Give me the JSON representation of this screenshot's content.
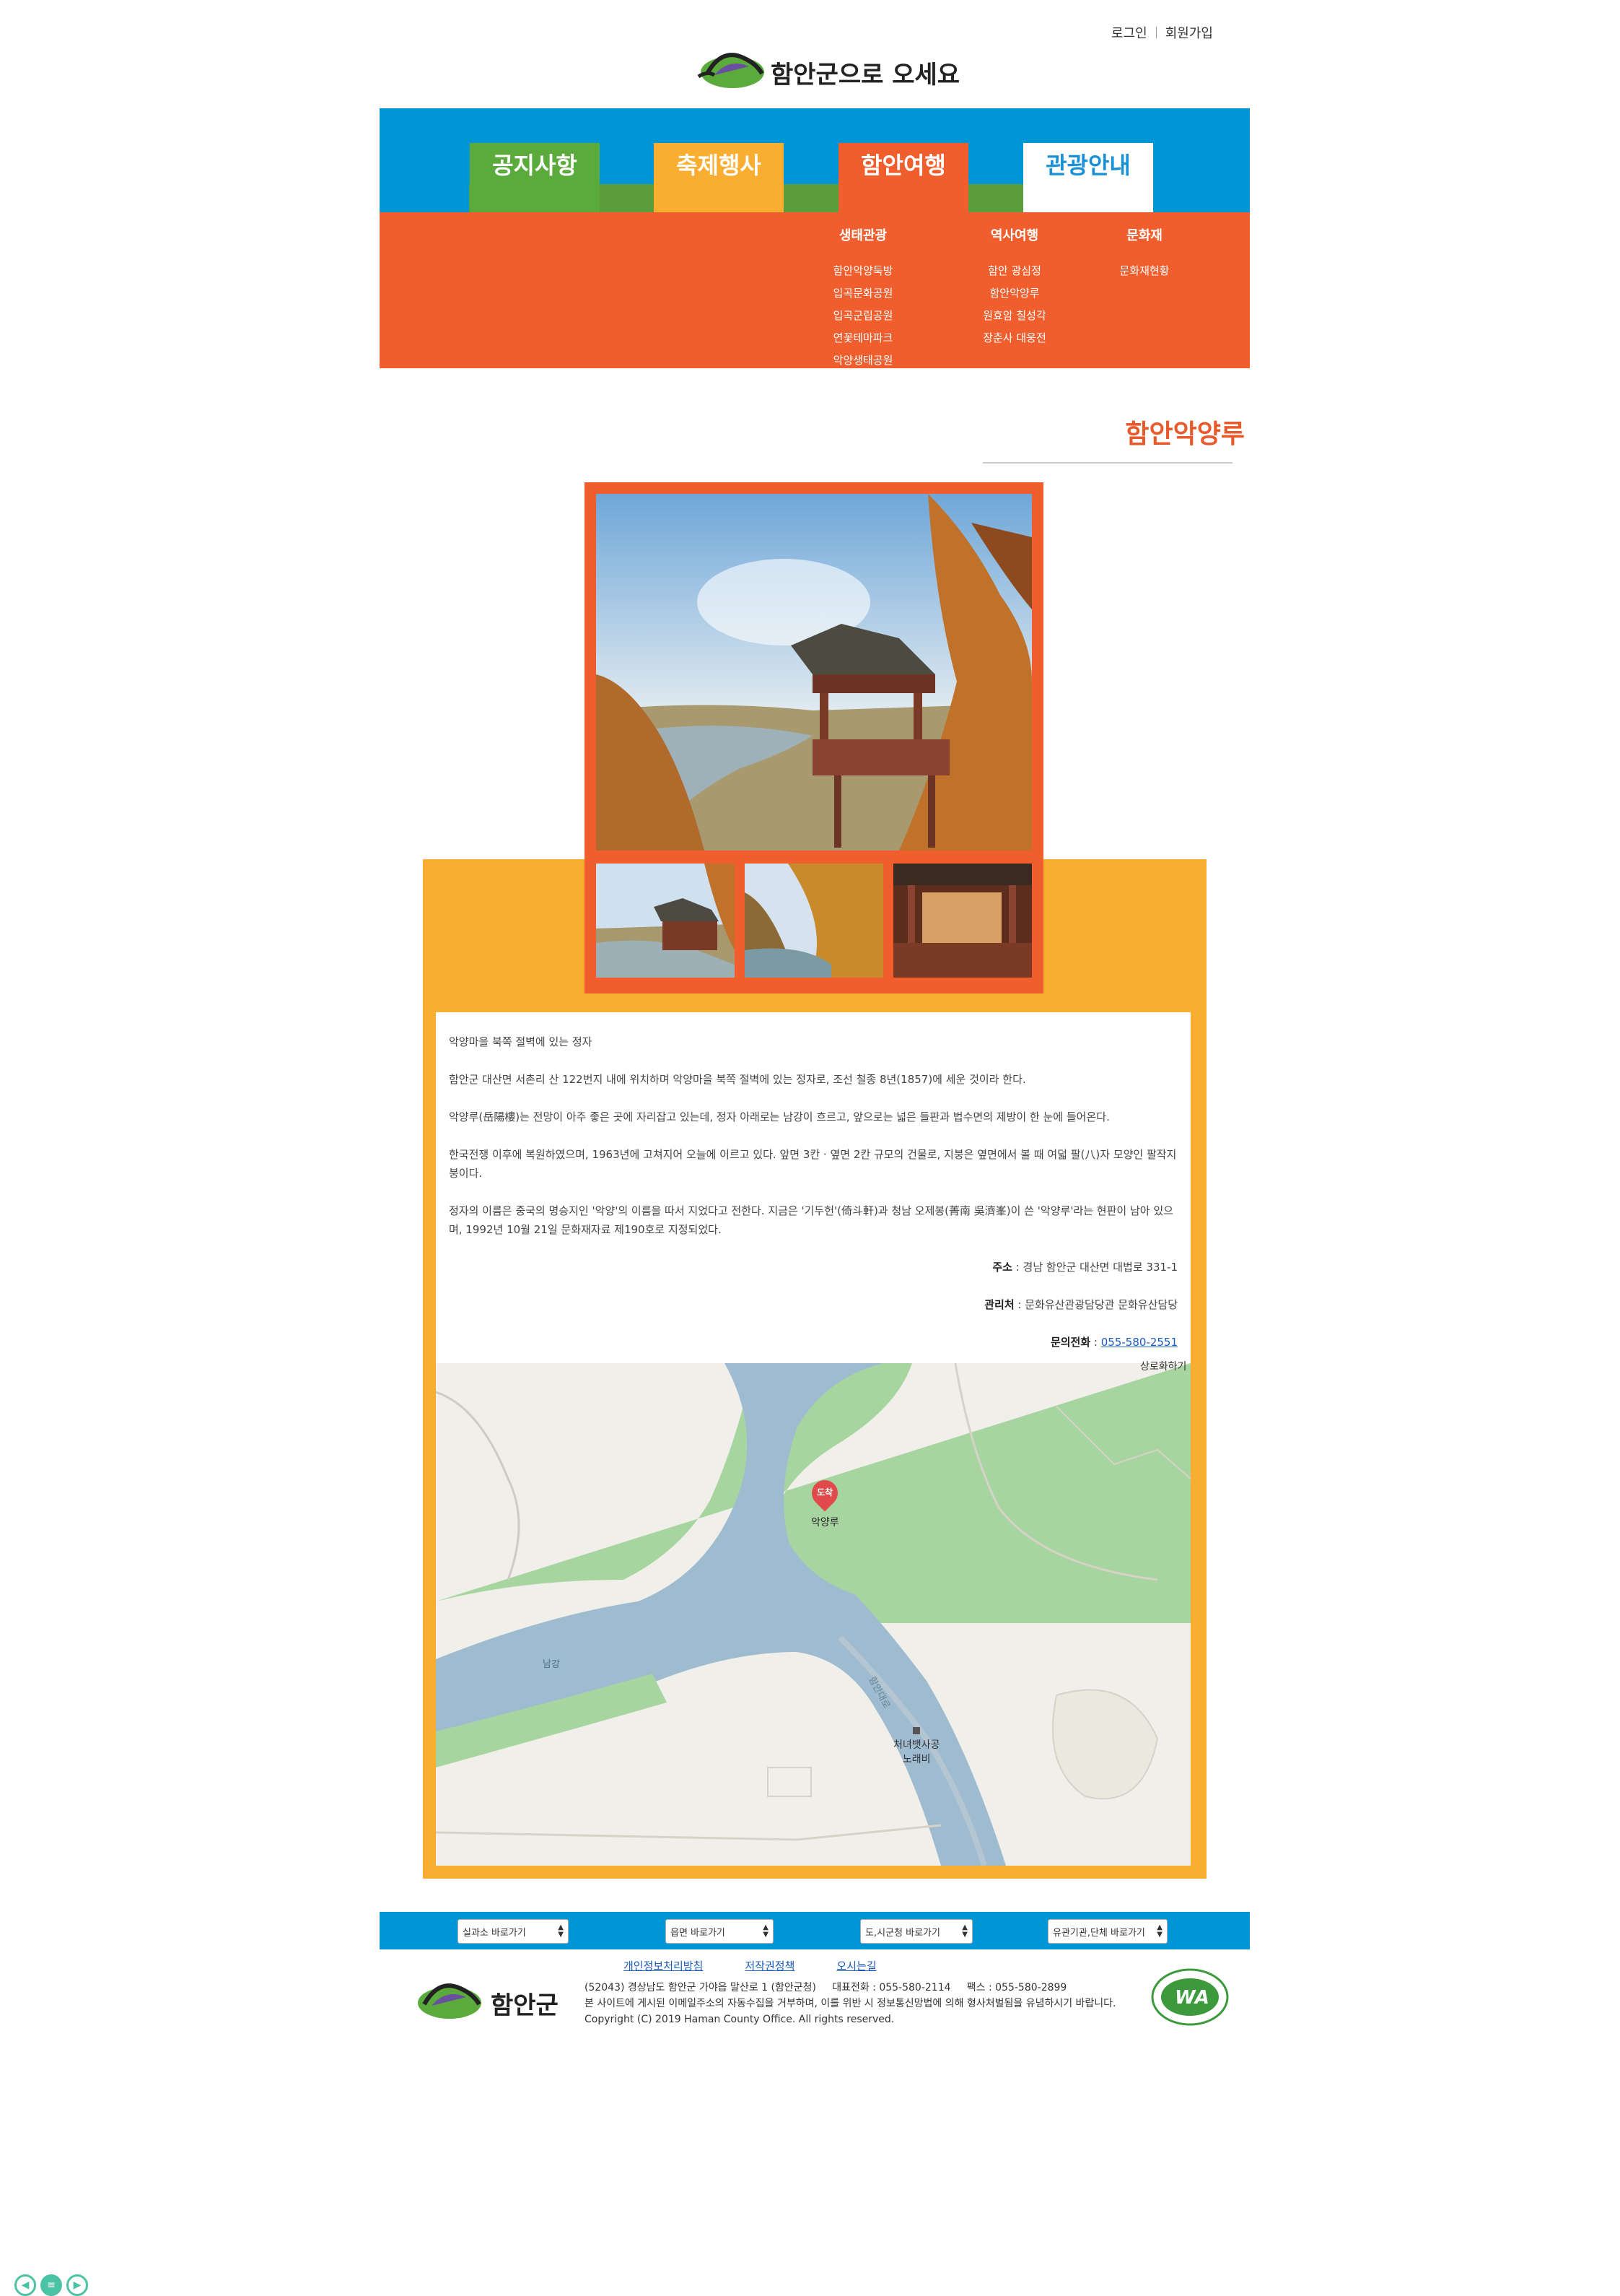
{
  "header": {
    "login": "로그인",
    "join": "회원가입",
    "logo_text": "함안군으로 오세요"
  },
  "nav": {
    "tabs": [
      {
        "label": "공지사항",
        "color": "#5aab3b"
      },
      {
        "label": "축제행사",
        "color": "#f9ae32"
      },
      {
        "label": "함안여행",
        "color": "#f05e2e"
      },
      {
        "label": "관광안내",
        "color": "#ffffff"
      }
    ],
    "menu": [
      {
        "head": "생태관광",
        "items": [
          "함안악양둑방",
          "입곡문화공원",
          "입곡군립공원",
          "연꽃테마파크",
          "악양생태공원"
        ]
      },
      {
        "head": "역사여행",
        "items": [
          "함안 광심정",
          "함안악양루",
          "원효암 칠성각",
          "장춘사 대웅전"
        ]
      },
      {
        "head": "문화재",
        "items": [
          "문화재현황"
        ]
      }
    ]
  },
  "page": {
    "title": "함안악양루"
  },
  "content": {
    "p1": "악양마을 북쪽 절벽에 있는 정자",
    "p2": "함안군 대산면 서촌리 산 122번지 내에 위치하며 악양마을 북쪽 절벽에 있는 정자로, 조선 철종 8년(1857)에 세운 것이라 한다.",
    "p3": "악양루(岳陽樓)는 전망이 아주 좋은 곳에 자리잡고 있는데, 정자 아래로는 남강이 흐르고, 앞으로는 넓은 들판과 법수면의 제방이 한 눈에 들어온다.",
    "p4": "한국전쟁 이후에 복원하였으며, 1963년에 고쳐지어 오늘에 이르고 있다. 앞면 3칸 · 옆면 2칸 규모의 건물로, 지붕은 옆면에서 볼 때 여덟 팔(八)자 모양인 팔작지붕이다.",
    "p5": "정자의 이름은 중국의 명승지인 '악양'의 이름을 따서 지었다고 전한다. 지금은 '기두헌'(倚斗軒)과 청남 오제봉(菁南 吳濟峯)이 쓴 '악양루'라는 현판이 남아 있으며, 1992년 10월 21일 문화재자료 제190호로 지정되었다.",
    "addr_label": "주소",
    "addr": " : 경남 함안군 대산면 대법로 331-1",
    "mgr_label": "관리처",
    "mgr": " : 문화유산관광담당관 문화유산담당",
    "tel_label": "문의전화",
    "tel_sep": " : ",
    "tel": "055-580-2551"
  },
  "map": {
    "link": "상로화하기",
    "marker_badge": "도착",
    "marker_label": "악양루",
    "river_label": "남강",
    "road_label": "함안대로",
    "poi_label_1": "처녀뱃사공",
    "poi_label_2": "노래비"
  },
  "footer": {
    "selects": [
      "실과소 바로가기",
      "읍면 바로가기",
      "도,시군청 바로가기",
      "유관기관,단체 바로가기"
    ],
    "links": [
      "개인정보처리방침",
      "저작권정책",
      "오시는길"
    ],
    "addr_line": "(52043) 경상남도 함안군 가야읍 말산로 1 (함안군청)     대표전화 : 055-580-2114     팩스 : 055-580-2899",
    "notice": "본 사이트에 게시된 이메일주소의 자동수집을 거부하며, 이를 위반 시 정보통신망법에 의해 형사처벌됨을 유념하시기 바랍니다.",
    "copyright": "Copyright (C) 2019 Haman County Office. All rights reserved.",
    "logo_text": "함안군",
    "wa_text": "WA"
  }
}
